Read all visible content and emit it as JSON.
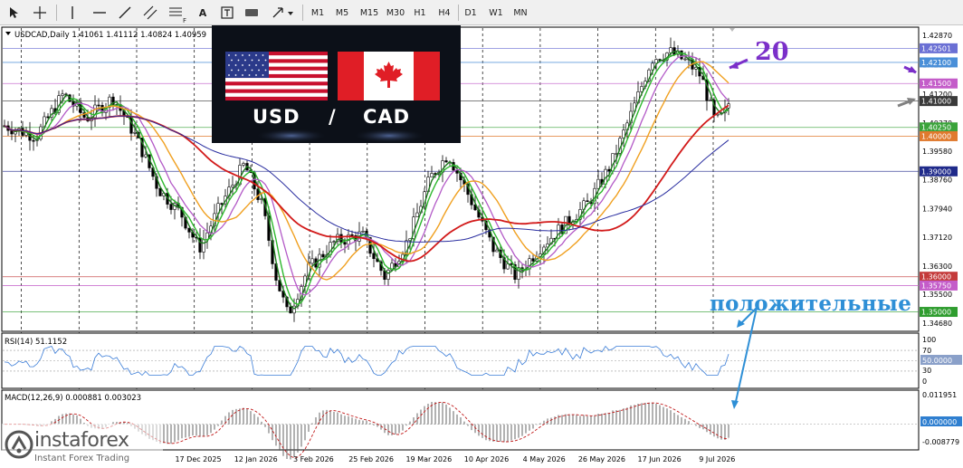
{
  "toolbar": {
    "timeframes": [
      "M1",
      "M5",
      "M15",
      "M30",
      "H1",
      "H4",
      "D1",
      "W1",
      "MN"
    ],
    "text_tool_label": "A",
    "fib_label": "F"
  },
  "main_chart": {
    "header": "USDCAD,Daily  1.41061 1.41112 1.40824 1.40959",
    "price_labels": [
      "1.42870",
      "1.42040",
      "1.41200",
      "1.40370",
      "1.39580",
      "1.38760",
      "1.37940",
      "1.37120",
      "1.36300",
      "1.35500",
      "1.34680"
    ],
    "highlighted_levels": [
      {
        "label": "1.42501",
        "bg": "#6a6fd4",
        "price": 1.42501
      },
      {
        "label": "1.42100",
        "bg": "#4a8fd8",
        "price": 1.421
      },
      {
        "label": "1.41500",
        "bg": "#c45cc9",
        "price": 1.415
      },
      {
        "label": "1.41000",
        "bg": "#3a3a3a",
        "price": 1.41
      },
      {
        "label": "1.40250",
        "bg": "#3aa33a",
        "price": 1.4025
      },
      {
        "label": "1.40000",
        "bg": "#e07a2e",
        "price": 1.4
      },
      {
        "label": "1.39000",
        "bg": "#1f2a8a",
        "price": 1.39
      },
      {
        "label": "1.36000",
        "bg": "#c43a3a",
        "price": 1.36
      },
      {
        "label": "1.35750",
        "bg": "#c45cc9",
        "price": 1.3575
      },
      {
        "label": "1.35000",
        "bg": "#2f9d2f",
        "price": 1.35
      }
    ],
    "price_range": [
      1.3455,
      1.43
    ]
  },
  "date_labels": [
    "17 Dec 2025",
    "12 Jan 2026",
    "3 Feb 2026",
    "25 Feb 2026",
    "19 Mar 2026",
    "10 Apr 2026",
    "4 May 2026",
    "26 May 2026",
    "17 Jun 2026",
    "9 Jul 2026"
  ],
  "rsi": {
    "header": "RSI(14) 51.1152",
    "labels": [
      "100",
      "70",
      "50.0000",
      "30",
      "0"
    ]
  },
  "macd": {
    "header": "MACD(12,26,9) 0.000881 0.003023",
    "labels": [
      "0.011951",
      "0.000000",
      "-0.008779"
    ]
  },
  "flags": {
    "left_label": "USD",
    "slash": "/",
    "right_label": "CAD"
  },
  "logo": {
    "name": "instaforex",
    "tagline": "Instant Forex Trading"
  },
  "annotations": {
    "number": "20",
    "word": "положительные"
  },
  "colors": {
    "ema_fast": "#1e7a1e",
    "ema_mid": "#2db82d",
    "ma_magenta": "#b35ac7",
    "ma_orange": "#f0a020",
    "ma_red": "#d21a1a",
    "ma_blue": "#2a2ea0",
    "annotation_purple": "#7b2fc9",
    "annotation_blue": "#2e8fd6"
  }
}
